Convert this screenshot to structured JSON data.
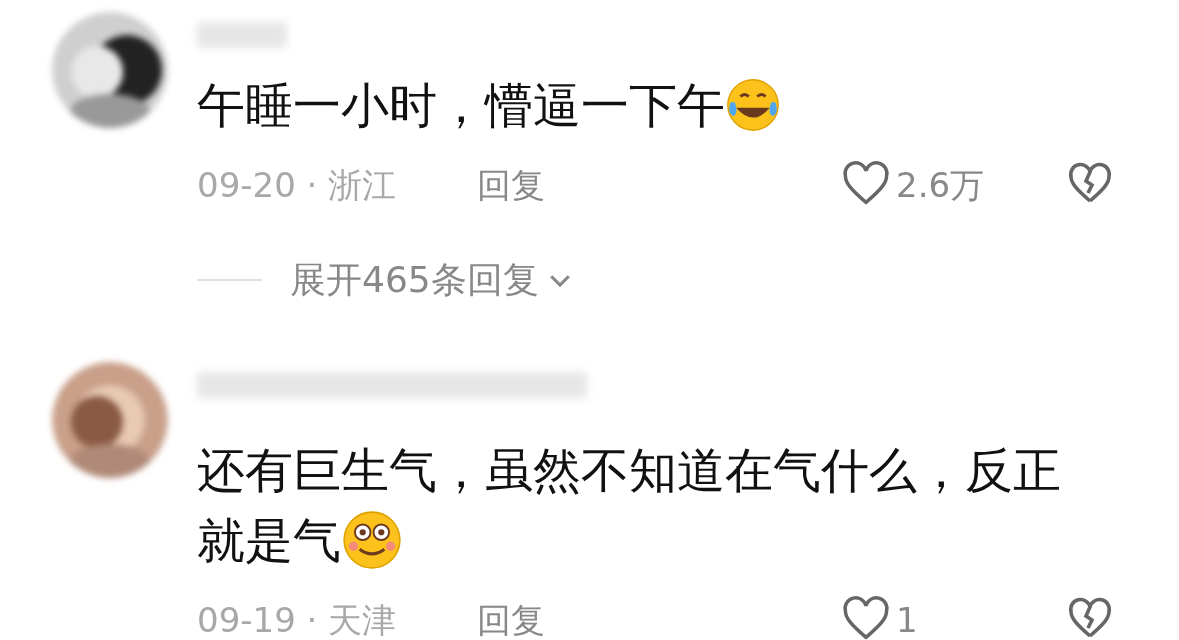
{
  "comments": [
    {
      "lines": [
        "午睡一小时，懵逼一下午"
      ],
      "kind": "tears_of_joy",
      "meta": "09-20 · 浙江",
      "reply": "回复",
      "likes": "2.6万",
      "expand": "展开465条回复"
    },
    {
      "lines": [
        "还有巨生气，虽然不知道在气什么，反正",
        "就是气"
      ],
      "kind": "smile",
      "meta": "09-19 · 天津",
      "reply": "回复",
      "likes": "1"
    }
  ]
}
